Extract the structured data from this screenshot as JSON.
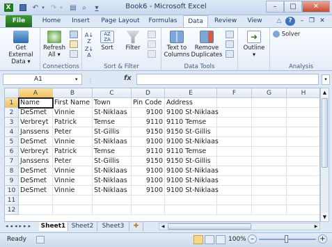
{
  "window": {
    "title": "Book6 - Microsoft Excel",
    "min_icon": "minimize-icon",
    "max_icon": "maximize-icon",
    "close_icon": "close-icon"
  },
  "ribbon_tabs": [
    "File",
    "Home",
    "Insert",
    "Page Layout",
    "Formulas",
    "Data",
    "Review",
    "View"
  ],
  "active_tab": "Data",
  "ribbon": {
    "get_external_data": "Get External Data",
    "refresh_all": "Refresh All",
    "connections_group": "Connections",
    "sort": "Sort",
    "filter": "Filter",
    "sort_filter_group": "Sort & Filter",
    "text_to_columns": "Text to Columns",
    "remove_duplicates": "Remove Duplicates",
    "data_tools_group": "Data Tools",
    "outline": "Outline",
    "solver": "Solver",
    "analysis_group": "Analysis"
  },
  "formula_bar": {
    "name_box": "A1",
    "fx": "fx",
    "content": ""
  },
  "columns": [
    "A",
    "B",
    "C",
    "D",
    "E",
    "F",
    "G",
    "H"
  ],
  "rows": [
    [
      "Name",
      "First Name",
      "Town",
      "Pin Code",
      "Address"
    ],
    [
      "DeSmet",
      "Vinnie",
      "St-Niklaas",
      "9100",
      "9100 St-Niklaas"
    ],
    [
      "Verbreyt",
      "Patrick",
      "Temse",
      "9110",
      "9110 Temse"
    ],
    [
      "Janssens",
      "Peter",
      "St-Gillis",
      "9150",
      "9150 St-Gillis"
    ],
    [
      "DeSmet",
      "Vinnie",
      "St-Niklaas",
      "9100",
      "9100 St-Niklaas"
    ],
    [
      "Verbreyt",
      "Patrick",
      "Temse",
      "9110",
      "9110 Temse"
    ],
    [
      "Janssens",
      "Peter",
      "St-Gillis",
      "9150",
      "9150 St-Gillis"
    ],
    [
      "DeSmet",
      "Vinnie",
      "St-Niklaas",
      "9100",
      "9100 St-Niklaas"
    ],
    [
      "DeSmet",
      "Vinnie",
      "St-Niklaas",
      "9100",
      "9100 St-Niklaas"
    ],
    [
      "DeSmet",
      "Vinnie",
      "St-Niklaas",
      "9100",
      "9100 St-Niklaas"
    ],
    [
      "",
      "",
      "",
      "",
      ""
    ],
    [
      "",
      "",
      "",
      "",
      ""
    ]
  ],
  "row_numbers": [
    "1",
    "2",
    "3",
    "4",
    "5",
    "6",
    "7",
    "8",
    "9",
    "10",
    "11",
    "12"
  ],
  "sheets": [
    "Sheet1",
    "Sheet2",
    "Sheet3"
  ],
  "active_sheet": "Sheet1",
  "status": {
    "ready": "Ready",
    "zoom": "100%"
  }
}
